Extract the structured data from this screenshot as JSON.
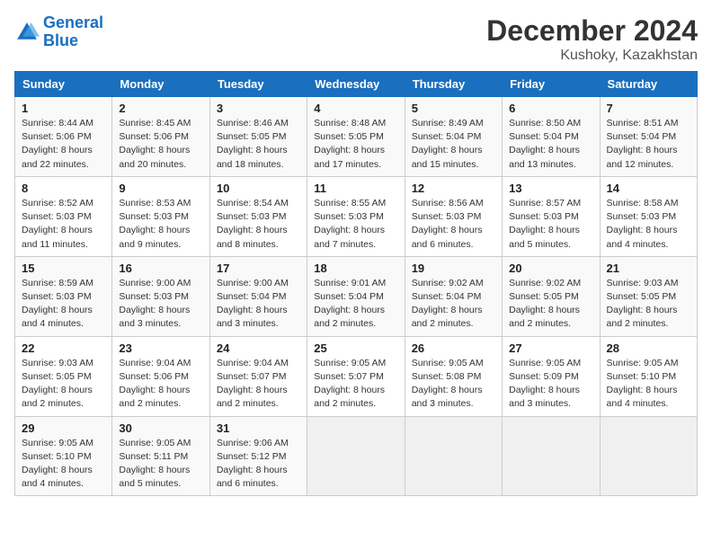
{
  "header": {
    "logo_line1": "General",
    "logo_line2": "Blue",
    "month": "December 2024",
    "location": "Kushoky, Kazakhstan"
  },
  "days_of_week": [
    "Sunday",
    "Monday",
    "Tuesday",
    "Wednesday",
    "Thursday",
    "Friday",
    "Saturday"
  ],
  "weeks": [
    [
      {
        "day": "1",
        "info": "Sunrise: 8:44 AM\nSunset: 5:06 PM\nDaylight: 8 hours and 22 minutes."
      },
      {
        "day": "2",
        "info": "Sunrise: 8:45 AM\nSunset: 5:06 PM\nDaylight: 8 hours and 20 minutes."
      },
      {
        "day": "3",
        "info": "Sunrise: 8:46 AM\nSunset: 5:05 PM\nDaylight: 8 hours and 18 minutes."
      },
      {
        "day": "4",
        "info": "Sunrise: 8:48 AM\nSunset: 5:05 PM\nDaylight: 8 hours and 17 minutes."
      },
      {
        "day": "5",
        "info": "Sunrise: 8:49 AM\nSunset: 5:04 PM\nDaylight: 8 hours and 15 minutes."
      },
      {
        "day": "6",
        "info": "Sunrise: 8:50 AM\nSunset: 5:04 PM\nDaylight: 8 hours and 13 minutes."
      },
      {
        "day": "7",
        "info": "Sunrise: 8:51 AM\nSunset: 5:04 PM\nDaylight: 8 hours and 12 minutes."
      }
    ],
    [
      {
        "day": "8",
        "info": "Sunrise: 8:52 AM\nSunset: 5:03 PM\nDaylight: 8 hours and 11 minutes."
      },
      {
        "day": "9",
        "info": "Sunrise: 8:53 AM\nSunset: 5:03 PM\nDaylight: 8 hours and 9 minutes."
      },
      {
        "day": "10",
        "info": "Sunrise: 8:54 AM\nSunset: 5:03 PM\nDaylight: 8 hours and 8 minutes."
      },
      {
        "day": "11",
        "info": "Sunrise: 8:55 AM\nSunset: 5:03 PM\nDaylight: 8 hours and 7 minutes."
      },
      {
        "day": "12",
        "info": "Sunrise: 8:56 AM\nSunset: 5:03 PM\nDaylight: 8 hours and 6 minutes."
      },
      {
        "day": "13",
        "info": "Sunrise: 8:57 AM\nSunset: 5:03 PM\nDaylight: 8 hours and 5 minutes."
      },
      {
        "day": "14",
        "info": "Sunrise: 8:58 AM\nSunset: 5:03 PM\nDaylight: 8 hours and 4 minutes."
      }
    ],
    [
      {
        "day": "15",
        "info": "Sunrise: 8:59 AM\nSunset: 5:03 PM\nDaylight: 8 hours and 4 minutes."
      },
      {
        "day": "16",
        "info": "Sunrise: 9:00 AM\nSunset: 5:03 PM\nDaylight: 8 hours and 3 minutes."
      },
      {
        "day": "17",
        "info": "Sunrise: 9:00 AM\nSunset: 5:04 PM\nDaylight: 8 hours and 3 minutes."
      },
      {
        "day": "18",
        "info": "Sunrise: 9:01 AM\nSunset: 5:04 PM\nDaylight: 8 hours and 2 minutes."
      },
      {
        "day": "19",
        "info": "Sunrise: 9:02 AM\nSunset: 5:04 PM\nDaylight: 8 hours and 2 minutes."
      },
      {
        "day": "20",
        "info": "Sunrise: 9:02 AM\nSunset: 5:05 PM\nDaylight: 8 hours and 2 minutes."
      },
      {
        "day": "21",
        "info": "Sunrise: 9:03 AM\nSunset: 5:05 PM\nDaylight: 8 hours and 2 minutes."
      }
    ],
    [
      {
        "day": "22",
        "info": "Sunrise: 9:03 AM\nSunset: 5:05 PM\nDaylight: 8 hours and 2 minutes."
      },
      {
        "day": "23",
        "info": "Sunrise: 9:04 AM\nSunset: 5:06 PM\nDaylight: 8 hours and 2 minutes."
      },
      {
        "day": "24",
        "info": "Sunrise: 9:04 AM\nSunset: 5:07 PM\nDaylight: 8 hours and 2 minutes."
      },
      {
        "day": "25",
        "info": "Sunrise: 9:05 AM\nSunset: 5:07 PM\nDaylight: 8 hours and 2 minutes."
      },
      {
        "day": "26",
        "info": "Sunrise: 9:05 AM\nSunset: 5:08 PM\nDaylight: 8 hours and 3 minutes."
      },
      {
        "day": "27",
        "info": "Sunrise: 9:05 AM\nSunset: 5:09 PM\nDaylight: 8 hours and 3 minutes."
      },
      {
        "day": "28",
        "info": "Sunrise: 9:05 AM\nSunset: 5:10 PM\nDaylight: 8 hours and 4 minutes."
      }
    ],
    [
      {
        "day": "29",
        "info": "Sunrise: 9:05 AM\nSunset: 5:10 PM\nDaylight: 8 hours and 4 minutes."
      },
      {
        "day": "30",
        "info": "Sunrise: 9:05 AM\nSunset: 5:11 PM\nDaylight: 8 hours and 5 minutes."
      },
      {
        "day": "31",
        "info": "Sunrise: 9:06 AM\nSunset: 5:12 PM\nDaylight: 8 hours and 6 minutes."
      },
      null,
      null,
      null,
      null
    ]
  ]
}
